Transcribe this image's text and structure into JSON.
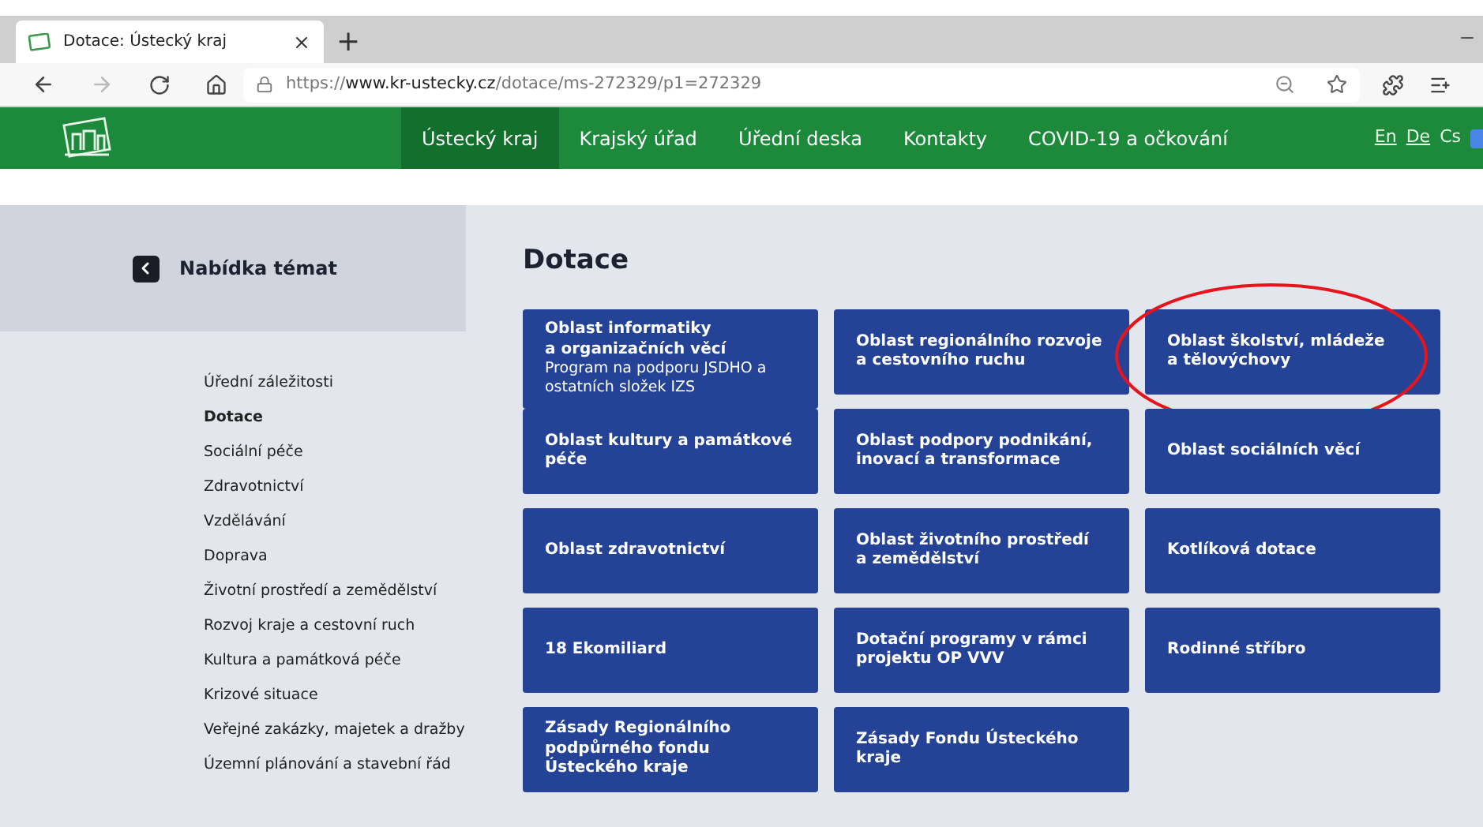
{
  "browser": {
    "tab_title": "Dotace: Ústecký kraj",
    "new_tab": "+",
    "url_prefix": "https://",
    "url_host": "www.kr-ustecky.cz",
    "url_path": "/dotace/ms-272329/p1=272329"
  },
  "nav": {
    "items": [
      {
        "label": "Ústecký kraj",
        "selected": true
      },
      {
        "label": "Krajský úřad",
        "selected": false
      },
      {
        "label": "Úřední deska",
        "selected": false
      },
      {
        "label": "Kontakty",
        "selected": false
      },
      {
        "label": "COVID-19 a očkování",
        "selected": false
      }
    ],
    "languages": [
      {
        "label": "En",
        "selected": false
      },
      {
        "label": "De",
        "selected": false
      },
      {
        "label": "Cs",
        "selected": true
      }
    ]
  },
  "sidebar": {
    "title": "Nabídka témat",
    "items": [
      {
        "label": "Úřední záležitosti",
        "selected": false
      },
      {
        "label": "Dotace",
        "selected": true
      },
      {
        "label": "Sociální péče",
        "selected": false
      },
      {
        "label": "Zdravotnictví",
        "selected": false
      },
      {
        "label": "Vzdělávání",
        "selected": false
      },
      {
        "label": "Doprava",
        "selected": false
      },
      {
        "label": "Životní prostředí a zemědělství",
        "selected": false
      },
      {
        "label": "Rozvoj kraje a cestovní ruch",
        "selected": false
      },
      {
        "label": "Kultura a památková péče",
        "selected": false
      },
      {
        "label": "Krizové situace",
        "selected": false
      },
      {
        "label": "Veřejné zakázky, majetek a dražby",
        "selected": false
      },
      {
        "label": "Územní plánování a stavební řád",
        "selected": false
      }
    ]
  },
  "heading": "Dotace",
  "cards": [
    {
      "lines": [
        "Oblast informatiky",
        "a organizačních věcí"
      ],
      "note": "Program na podporu JSDHO a ostatních složek IZS",
      "highlighted": false
    },
    {
      "lines": [
        "Oblast regionálního rozvoje",
        "a cestovního ruchu"
      ],
      "highlighted": false
    },
    {
      "lines": [
        "Oblast školství, mládeže",
        "a tělovýchovy"
      ],
      "highlighted": true
    },
    {
      "lines": [
        "Oblast kultury a památkové",
        "péče"
      ],
      "highlighted": false
    },
    {
      "lines": [
        "Oblast podpory podnikání,",
        "inovací a transformace"
      ],
      "highlighted": false
    },
    {
      "lines": [
        "Oblast sociálních věcí"
      ],
      "highlighted": false
    },
    {
      "lines": [
        "Oblast zdravotnictví"
      ],
      "highlighted": false
    },
    {
      "lines": [
        "Oblast životního prostředí",
        "a zemědělství"
      ],
      "highlighted": false
    },
    {
      "lines": [
        "Kotlíková dotace"
      ],
      "highlighted": false
    },
    {
      "lines": [
        "18 Ekomiliard"
      ],
      "highlighted": false
    },
    {
      "lines": [
        "Dotační programy v rámci",
        "projektu OP VVV"
      ],
      "highlighted": false
    },
    {
      "lines": [
        "Rodinné stříbro"
      ],
      "highlighted": false
    },
    {
      "lines": [
        "Zásady Regionálního",
        "podpůrného fondu",
        "Ústeckého kraje"
      ],
      "highlighted": false
    },
    {
      "lines": [
        "Zásady Fondu Ústeckého",
        "kraje"
      ],
      "highlighted": false
    }
  ]
}
